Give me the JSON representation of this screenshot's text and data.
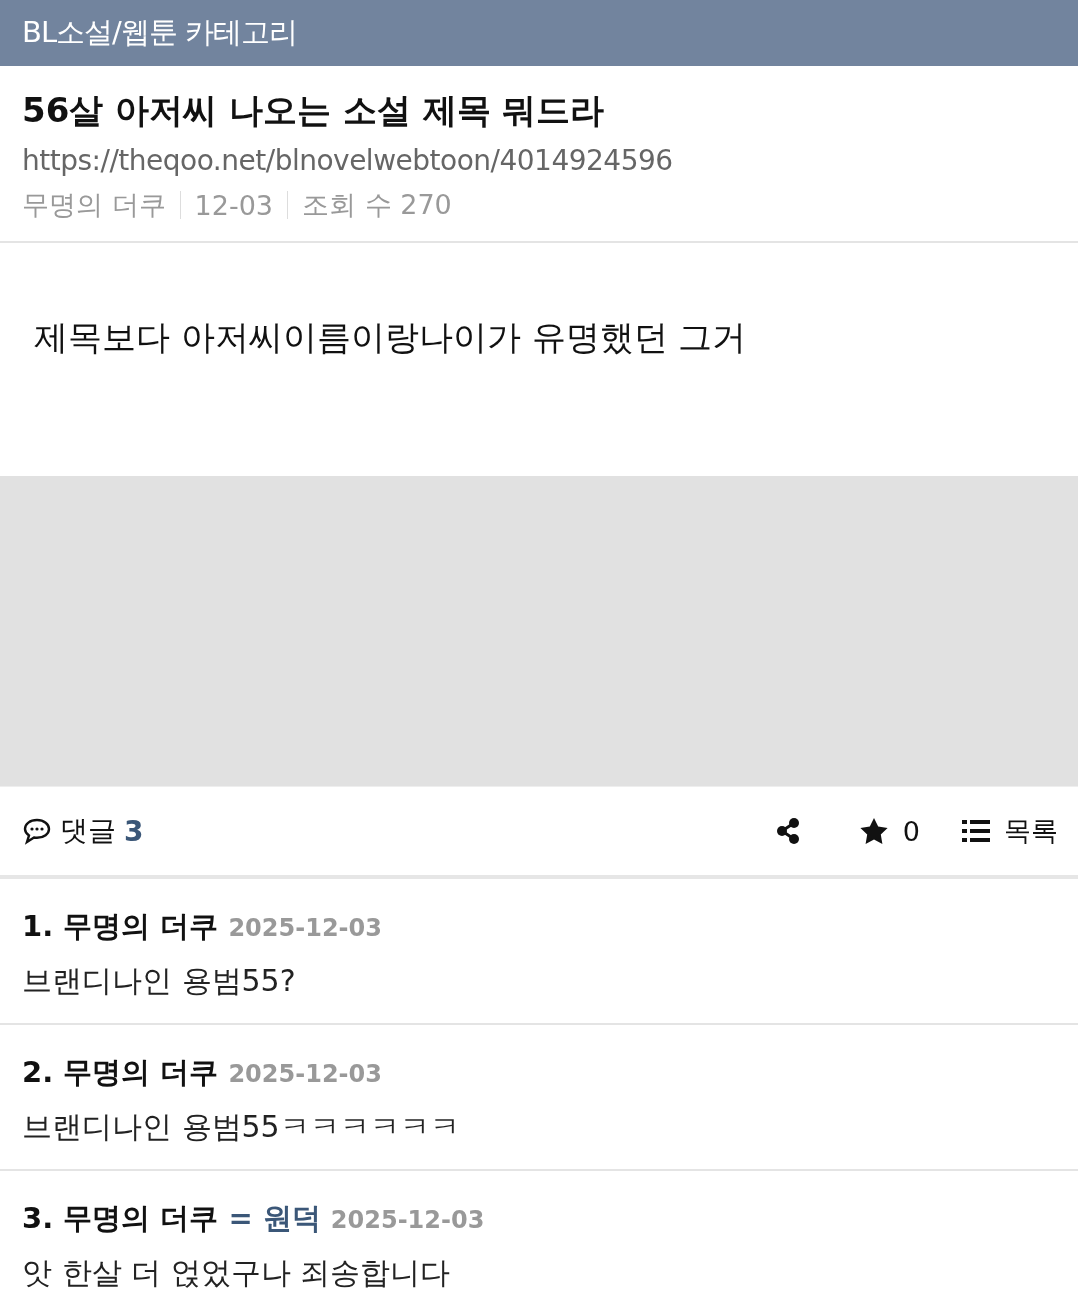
{
  "header": {
    "category": "BL소설/웹툰 카테고리"
  },
  "post": {
    "title": "56살 아저씨 나오는 소설 제목 뭐드라",
    "url": "https://theqoo.net/blnovelwebtoon/4014924596",
    "author": "무명의 더쿠",
    "date": "12-03",
    "views": "조회 수 270",
    "body": "제목보다 아저씨이름이랑나이가 유명했던 그거"
  },
  "actions": {
    "comments_label": "댓글",
    "comments_count": "3",
    "stars_count": "0",
    "list_label": "목록"
  },
  "comments": [
    {
      "number": "1.",
      "author": "무명의 더쿠",
      "date": "2025-12-03",
      "text": "브랜디나인 용범55?"
    },
    {
      "number": "2.",
      "author": "무명의 더쿠",
      "date": "2025-12-03",
      "text": "브랜디나인 용범55ㅋㅋㅋㅋㅋㅋ"
    },
    {
      "number": "3.",
      "author": "무명의 더쿠",
      "op_mark": "= 원덕",
      "date": "2025-12-03",
      "text": "앗 한살 더 얹었구나 죄송합니다"
    }
  ]
}
